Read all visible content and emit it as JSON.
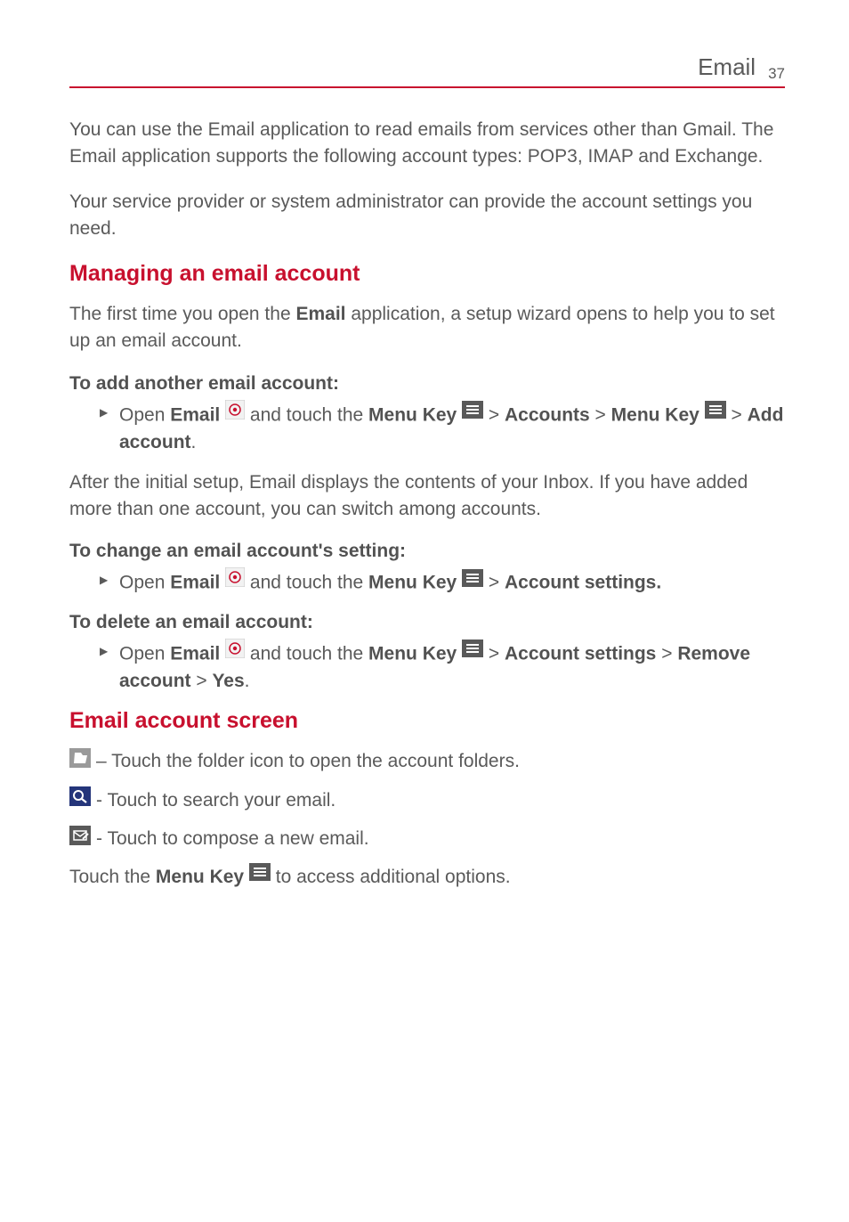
{
  "header": {
    "title": "Email",
    "page_number": "37"
  },
  "intro": {
    "p1": "You can use the Email application to read emails from services other than Gmail. The Email application supports the following account types: POP3, IMAP and Exchange.",
    "p2": "Your service provider or system administrator can provide the account settings you need."
  },
  "managing": {
    "title": "Managing an email account",
    "intro_a": "The first time you open the ",
    "intro_b": "Email",
    "intro_c": " application, a setup wizard opens to help you to set up an email account.",
    "add_head": "To add another email account:",
    "add_step": {
      "a": " Open ",
      "b": "Email ",
      "c": " and touch the ",
      "d": "Menu Key ",
      "e": " > ",
      "f": "Accounts",
      "g": " > ",
      "h": "Menu Key ",
      "i": " > ",
      "j": "Add account",
      "k": "."
    },
    "after": "After the initial setup, Email displays the contents of your Inbox. If you have added more than one account, you can switch among accounts.",
    "change_head": "To change an email account's setting:",
    "change_step": {
      "a": " Open ",
      "b": "Email ",
      "c": " and touch the ",
      "d": "Menu Key ",
      "e": " > ",
      "f": "Account settings."
    },
    "delete_head": "To delete an email account:",
    "delete_step": {
      "a": " Open ",
      "b": "Email ",
      "c": " and touch the ",
      "d": "Menu Key ",
      "e": " > ",
      "f": "Account settings",
      "g": " > ",
      "h": "Remove account",
      "i": " > ",
      "j": "Yes",
      "k": "."
    }
  },
  "screen": {
    "title": "Email account screen",
    "folder": " – Touch the folder icon to open the account folders.",
    "search": " - Touch to search your email.",
    "compose": " - Touch to compose a new email.",
    "menu_a": "Touch the ",
    "menu_b": "Menu Key ",
    "menu_c": " to access additional options."
  }
}
